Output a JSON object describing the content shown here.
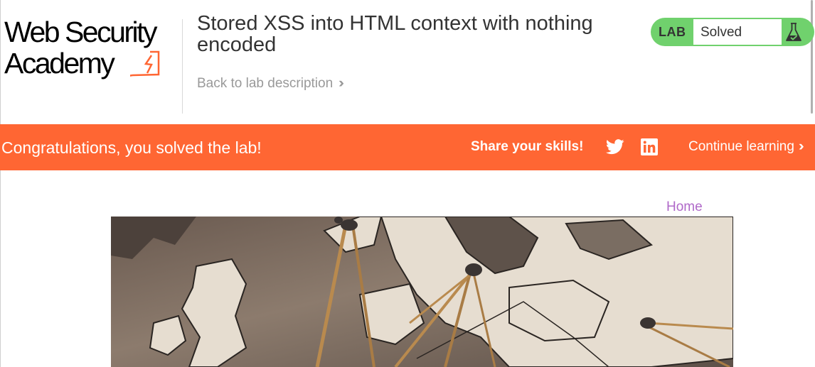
{
  "logo": {
    "line1": "Web Security",
    "line2": "Academy",
    "accent": "#ff6633"
  },
  "lab": {
    "title": "Stored XSS into HTML context with nothing encoded",
    "back_link": "Back to lab description",
    "status_label": "LAB",
    "status_value": "Solved",
    "status_color": "#70d16d"
  },
  "banner": {
    "message": "Congratulations, you solved the lab!",
    "share": "Share your skills!",
    "continue": "Continue learning",
    "color": "#ff6633"
  },
  "nav": {
    "home": "Home"
  },
  "icons": [
    "flask-icon",
    "twitter-icon",
    "linkedin-icon",
    "chevron-right-icon"
  ]
}
